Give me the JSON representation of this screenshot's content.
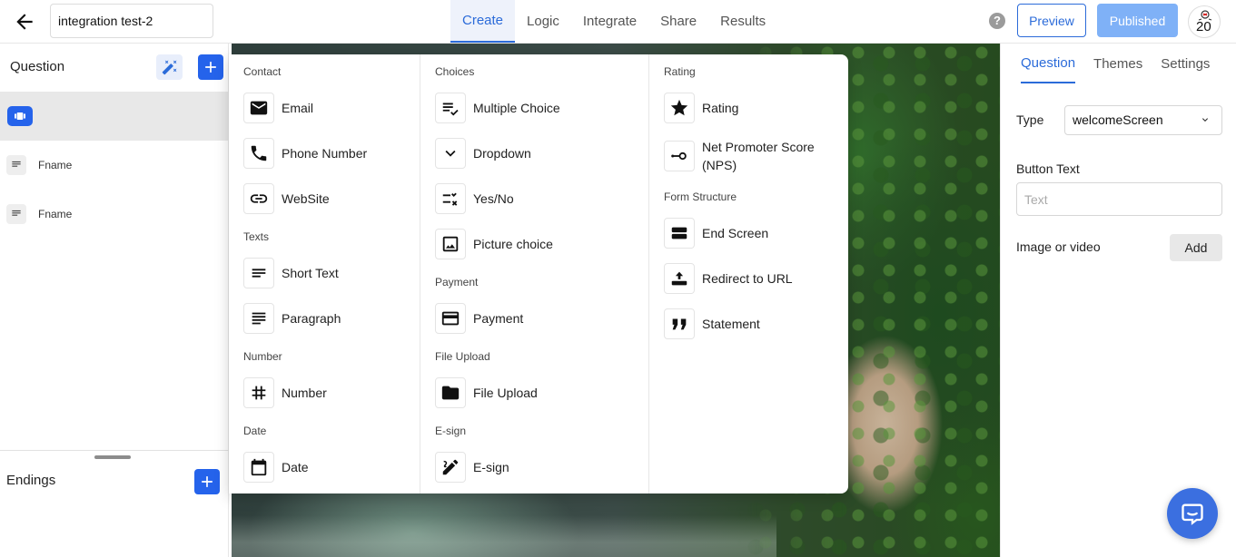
{
  "header": {
    "form_title": "integration test-2",
    "tabs": [
      {
        "label": "Create",
        "active": true
      },
      {
        "label": "Logic",
        "active": false
      },
      {
        "label": "Integrate",
        "active": false
      },
      {
        "label": "Share",
        "active": false
      },
      {
        "label": "Results",
        "active": false
      }
    ],
    "help_glyph": "?",
    "preview_label": "Preview",
    "published_label": "Published",
    "avatar_text": "20"
  },
  "left_panel": {
    "questions_title": "Question",
    "items": [
      {
        "label": "",
        "icon": "welcome-screen-icon",
        "selected": true
      },
      {
        "label": "Fname",
        "icon": "short-text-icon",
        "selected": false
      },
      {
        "label": "Fname",
        "icon": "short-text-icon",
        "selected": false
      }
    ],
    "endings_title": "Endings"
  },
  "menu": {
    "columns": [
      {
        "sections": [
          {
            "title": "Contact",
            "items": [
              {
                "label": "Email",
                "icon": "email-icon"
              },
              {
                "label": "Phone Number",
                "icon": "phone-icon"
              },
              {
                "label": "WebSite",
                "icon": "link-icon"
              }
            ]
          },
          {
            "title": "Texts",
            "items": [
              {
                "label": "Short Text",
                "icon": "short-text-icon"
              },
              {
                "label": "Paragraph",
                "icon": "paragraph-icon"
              }
            ]
          },
          {
            "title": "Number",
            "items": [
              {
                "label": "Number",
                "icon": "hash-icon"
              }
            ]
          },
          {
            "title": "Date",
            "items": [
              {
                "label": "Date",
                "icon": "calendar-icon"
              }
            ]
          }
        ]
      },
      {
        "sections": [
          {
            "title": "Choices",
            "items": [
              {
                "label": "Multiple Choice",
                "icon": "checklist-icon"
              },
              {
                "label": "Dropdown",
                "icon": "chevron-down-icon"
              },
              {
                "label": "Yes/No",
                "icon": "yes-no-icon"
              },
              {
                "label": "Picture choice",
                "icon": "image-icon"
              }
            ]
          },
          {
            "title": "Payment",
            "items": [
              {
                "label": "Payment",
                "icon": "credit-card-icon"
              }
            ]
          },
          {
            "title": "File Upload",
            "items": [
              {
                "label": "File Upload",
                "icon": "folder-icon"
              }
            ]
          },
          {
            "title": "E-sign",
            "items": [
              {
                "label": "E-sign",
                "icon": "signature-icon"
              }
            ]
          }
        ]
      },
      {
        "sections": [
          {
            "title": "Rating",
            "items": [
              {
                "label": "Rating",
                "icon": "star-icon"
              },
              {
                "label": "Net Promoter Score (NPS)",
                "icon": "nps-icon"
              }
            ]
          },
          {
            "title": "Form Structure",
            "items": [
              {
                "label": "End Screen",
                "icon": "end-screen-icon"
              },
              {
                "label": "Redirect to URL",
                "icon": "redirect-icon"
              },
              {
                "label": "Statement",
                "icon": "quote-icon"
              }
            ]
          }
        ]
      }
    ]
  },
  "right_panel": {
    "tabs": [
      {
        "label": "Question",
        "active": true
      },
      {
        "label": "Themes",
        "active": false
      },
      {
        "label": "Settings",
        "active": false
      }
    ],
    "type_label": "Type",
    "type_value": "welcomeScreen",
    "button_text_label": "Button Text",
    "button_text_placeholder": "Text",
    "media_label": "Image or video",
    "media_add_label": "Add"
  },
  "colors": {
    "accent": "#2b6bd9",
    "button_blue": "#2563eb",
    "published_bg": "#7fb1f7",
    "chat_bg": "#3b6fe0"
  }
}
